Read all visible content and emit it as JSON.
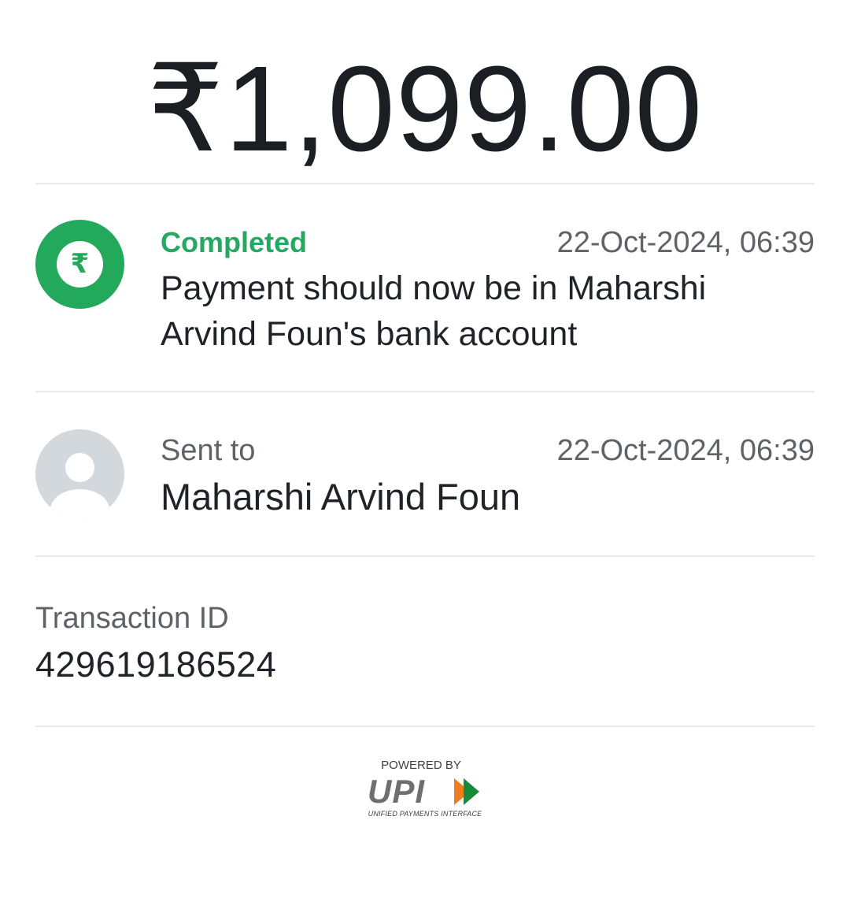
{
  "payment": {
    "amount": "₹1,099.00"
  },
  "status": {
    "icon": "rupee-icon",
    "label": "Completed",
    "timestamp": "22-Oct-2024, 06:39",
    "message": "Payment should now be in Maharshi Arvind Foun's bank account",
    "color": "#22a95b"
  },
  "recipient": {
    "icon": "user-avatar-icon",
    "label": "Sent to",
    "timestamp": "22-Oct-2024, 06:39",
    "name": "Maharshi Arvind Foun"
  },
  "transaction": {
    "label": "Transaction ID",
    "id": "429619186524"
  },
  "branding": {
    "powered_by": "POWERED BY",
    "logo_text": "UPI",
    "tagline": "UNIFIED PAYMENTS INTERFACE",
    "colors": [
      "#6f6f6f",
      "#ef7d22",
      "#188b3a"
    ]
  }
}
